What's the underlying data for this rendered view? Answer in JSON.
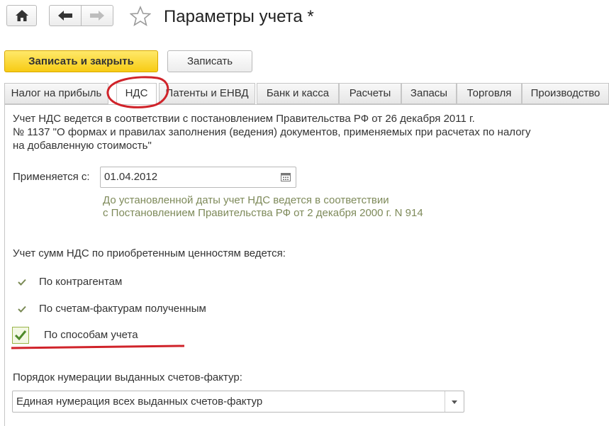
{
  "window": {
    "title": "Параметры учета *"
  },
  "toolbar": {
    "save_close_label": "Записать и закрыть",
    "save_label": "Записать"
  },
  "tabs": [
    {
      "label": "Налог на прибыль"
    },
    {
      "label": "НДС"
    },
    {
      "label": "Патенты и ЕНВД"
    },
    {
      "label": "Банк и касса"
    },
    {
      "label": "Расчеты"
    },
    {
      "label": "Запасы"
    },
    {
      "label": "Торговля"
    },
    {
      "label": "Производство"
    }
  ],
  "active_tab": "НДС",
  "vat": {
    "info_line1": "Учет НДС ведется в соответствии с постановлением Правительства РФ от 26 декабря 2011 г.",
    "info_line2": "№ 1137 \"О формах и правилах заполнения (ведения) документов, применяемых при расчетах по налогу",
    "info_line3": "на добавленную стоимость\"",
    "applies_from_label": "Применяется с:",
    "applies_from_value": "01.04.2012",
    "hint_line1": "До установленной даты учет НДС ведется в соответствии",
    "hint_line2": "с Постановлением Правительства РФ от 2 декабря 2000 г. N 914",
    "accounting_heading": "Учет сумм НДС по приобретенным ценностям ведется:",
    "by_counterparties": "По контрагентам",
    "by_invoices": "По счетам-фактурам полученным",
    "by_accounting_methods": "По способам учета",
    "by_accounting_methods_checked": true,
    "numbering_label": "Порядок нумерации выданных счетов-фактур:",
    "numbering_value": "Единая нумерация всех выданных счетов-фактур"
  },
  "colors": {
    "primary_button": "#f7cb14",
    "hint_text": "#7e8a5a",
    "annotation": "#d0232a",
    "checkmark": "#4e8a2a"
  }
}
